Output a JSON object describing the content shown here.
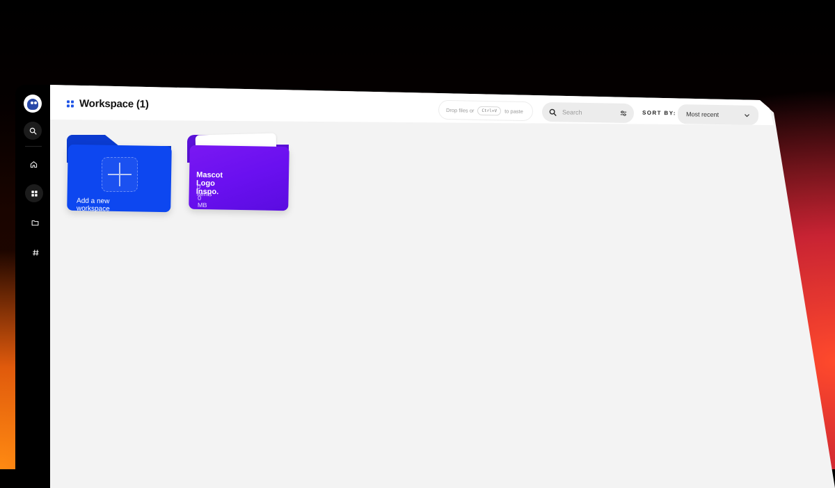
{
  "header": {
    "title": "Workspace (1)",
    "drop_hint_prefix": "Drop files or",
    "drop_hint_key": "Ctrl+V",
    "drop_hint_suffix": "to paste",
    "search_placeholder": "Search",
    "sort_label": "SORT BY:",
    "sort_value": "Most recent"
  },
  "sidebar": {
    "items": [
      {
        "icon": "search-icon"
      },
      {
        "icon": "home-icon"
      },
      {
        "icon": "grid-icon",
        "active": true
      },
      {
        "icon": "folder-icon"
      },
      {
        "icon": "hash-icon"
      }
    ]
  },
  "workspaces": {
    "add_label": "Add a new workspace",
    "items": [
      {
        "name": "Mascot Logo Inspo.",
        "count": "0 items",
        "size": "0 MB"
      }
    ]
  },
  "colors": {
    "accent_blue": "#0d47f0",
    "accent_purple": "#6a10f0"
  }
}
